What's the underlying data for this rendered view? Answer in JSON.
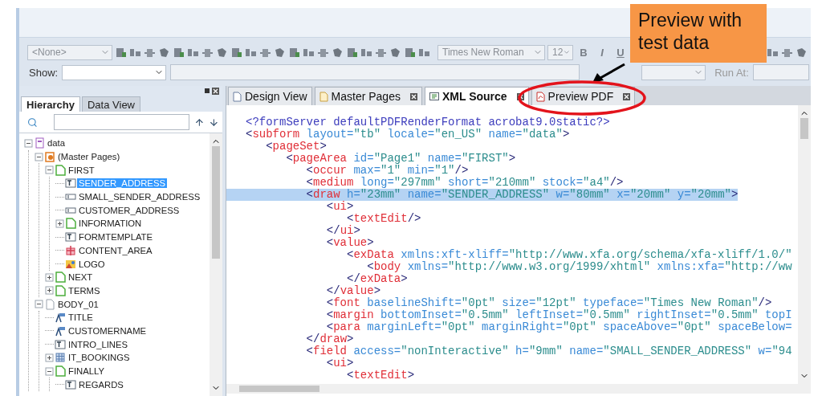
{
  "toolbar": {
    "object_select": "<None>",
    "font": "Times New Roman",
    "size": "12",
    "styles": [
      "B",
      "I",
      "U"
    ]
  },
  "script_bar": {
    "show_label": "Show:",
    "run_at_label": "Run At:"
  },
  "hierarchy": {
    "tabs": [
      {
        "label": "Hierarchy",
        "selected": true
      },
      {
        "label": "Data View",
        "selected": false
      }
    ],
    "tree": [
      {
        "label": "data",
        "kind": "root",
        "expanded": true,
        "selected": false,
        "children": [
          {
            "label": "(Master Pages)",
            "kind": "masterpages",
            "expanded": true,
            "selected": false,
            "children": [
              {
                "label": "FIRST",
                "kind": "page",
                "expanded": true,
                "selected": false,
                "children": [
                  {
                    "label": "SENDER_ADDRESS",
                    "kind": "text",
                    "selected": true
                  },
                  {
                    "label": "SMALL_SENDER_ADDRESS",
                    "kind": "field",
                    "selected": false
                  },
                  {
                    "label": "CUSTOMER_ADDRESS",
                    "kind": "field",
                    "selected": false
                  },
                  {
                    "label": "INFORMATION",
                    "kind": "page",
                    "expanded": false,
                    "selected": false
                  },
                  {
                    "label": "FORMTEMPLATE",
                    "kind": "text",
                    "selected": false
                  },
                  {
                    "label": "CONTENT_AREA",
                    "kind": "content",
                    "selected": false
                  },
                  {
                    "label": "LOGO",
                    "kind": "image",
                    "selected": false
                  }
                ]
              },
              {
                "label": "NEXT",
                "kind": "page",
                "expanded": false,
                "selected": false
              },
              {
                "label": "TERMS",
                "kind": "page",
                "expanded": false,
                "selected": false
              }
            ]
          },
          {
            "label": "BODY_01",
            "kind": "body",
            "expanded": true,
            "selected": false,
            "children": [
              {
                "label": "TITLE",
                "kind": "caption",
                "selected": false
              },
              {
                "label": "CUSTOMERNAME",
                "kind": "caption",
                "selected": false
              },
              {
                "label": "INTRO_LINES",
                "kind": "text",
                "selected": false
              },
              {
                "label": "IT_BOOKINGS",
                "kind": "table",
                "expanded": false,
                "selected": false
              },
              {
                "label": "FINALLY",
                "kind": "subform",
                "expanded": true,
                "selected": false,
                "children": [
                  {
                    "label": "REGARDS",
                    "kind": "text",
                    "selected": false
                  }
                ]
              }
            ]
          }
        ]
      }
    ]
  },
  "editor": {
    "tabs": [
      {
        "label": "Design View",
        "kind": "design",
        "selected": false,
        "closable": false
      },
      {
        "label": "Master Pages",
        "kind": "master",
        "selected": false,
        "closable": true
      },
      {
        "label": "XML Source",
        "kind": "xml",
        "selected": true,
        "closable": true
      },
      {
        "label": "Preview PDF",
        "kind": "pdf",
        "selected": false,
        "closable": true
      }
    ],
    "lines": [
      {
        "selected": false,
        "tokens": [
          {
            "kind": "pi",
            "text": "<?formServer defaultPDFRenderFormat acrobat9.0static?>"
          }
        ]
      },
      {
        "selected": false,
        "tokens": [
          {
            "kind": "punct",
            "text": "<"
          },
          {
            "kind": "tag",
            "text": "subform"
          },
          {
            "kind": "attr",
            "text": " layout="
          },
          {
            "kind": "value",
            "text": "\"tb\""
          },
          {
            "kind": "attr",
            "text": " locale="
          },
          {
            "kind": "value",
            "text": "\"en_US\""
          },
          {
            "kind": "attr",
            "text": " name="
          },
          {
            "kind": "value",
            "text": "\"data\""
          },
          {
            "kind": "punct",
            "text": ">"
          }
        ]
      },
      {
        "selected": false,
        "tokens": [
          {
            "kind": "punct",
            "text": "   <"
          },
          {
            "kind": "tag",
            "text": "pageSet"
          },
          {
            "kind": "punct",
            "text": ">"
          }
        ]
      },
      {
        "selected": false,
        "tokens": [
          {
            "kind": "punct",
            "text": "      <"
          },
          {
            "kind": "tag",
            "text": "pageArea"
          },
          {
            "kind": "attr",
            "text": " id="
          },
          {
            "kind": "value",
            "text": "\"Page1\""
          },
          {
            "kind": "attr",
            "text": " name="
          },
          {
            "kind": "value",
            "text": "\"FIRST\""
          },
          {
            "kind": "punct",
            "text": ">"
          }
        ]
      },
      {
        "selected": false,
        "tokens": [
          {
            "kind": "punct",
            "text": "         <"
          },
          {
            "kind": "tag",
            "text": "occur"
          },
          {
            "kind": "attr",
            "text": " max="
          },
          {
            "kind": "value",
            "text": "\"1\""
          },
          {
            "kind": "attr",
            "text": " min="
          },
          {
            "kind": "value",
            "text": "\"1\""
          },
          {
            "kind": "punct",
            "text": "/>"
          }
        ]
      },
      {
        "selected": false,
        "tokens": [
          {
            "kind": "punct",
            "text": "         <"
          },
          {
            "kind": "tag",
            "text": "medium"
          },
          {
            "kind": "attr",
            "text": " long="
          },
          {
            "kind": "value",
            "text": "\"297mm\""
          },
          {
            "kind": "attr",
            "text": " short="
          },
          {
            "kind": "value",
            "text": "\"210mm\""
          },
          {
            "kind": "attr",
            "text": " stock="
          },
          {
            "kind": "value",
            "text": "\"a4\""
          },
          {
            "kind": "punct",
            "text": "/>"
          }
        ]
      },
      {
        "selected": true,
        "tokens": [
          {
            "kind": "punct",
            "text": "         <"
          },
          {
            "kind": "tag",
            "text": "draw"
          },
          {
            "kind": "attr",
            "text": " h="
          },
          {
            "kind": "value",
            "text": "\"23mm\""
          },
          {
            "kind": "attr",
            "text": " name="
          },
          {
            "kind": "value",
            "text": "\"SENDER_ADDRESS\""
          },
          {
            "kind": "attr",
            "text": " w="
          },
          {
            "kind": "value",
            "text": "\"80mm\""
          },
          {
            "kind": "attr",
            "text": " x="
          },
          {
            "kind": "value",
            "text": "\"20mm\""
          },
          {
            "kind": "attr",
            "text": " y="
          },
          {
            "kind": "value",
            "text": "\"20mm\""
          },
          {
            "kind": "punct",
            "text": ">"
          }
        ]
      },
      {
        "selected": false,
        "tokens": [
          {
            "kind": "punct",
            "text": "            <"
          },
          {
            "kind": "tag",
            "text": "ui"
          },
          {
            "kind": "punct",
            "text": ">"
          }
        ]
      },
      {
        "selected": false,
        "tokens": [
          {
            "kind": "punct",
            "text": "               <"
          },
          {
            "kind": "tag",
            "text": "textEdit"
          },
          {
            "kind": "punct",
            "text": "/>"
          }
        ]
      },
      {
        "selected": false,
        "tokens": [
          {
            "kind": "punct",
            "text": "            </"
          },
          {
            "kind": "tag",
            "text": "ui"
          },
          {
            "kind": "punct",
            "text": ">"
          }
        ]
      },
      {
        "selected": false,
        "tokens": [
          {
            "kind": "punct",
            "text": "            <"
          },
          {
            "kind": "tag",
            "text": "value"
          },
          {
            "kind": "punct",
            "text": ">"
          }
        ]
      },
      {
        "selected": false,
        "tokens": [
          {
            "kind": "punct",
            "text": "               <"
          },
          {
            "kind": "tag",
            "text": "exData"
          },
          {
            "kind": "attr",
            "text": " xmlns:xft-xliff="
          },
          {
            "kind": "value",
            "text": "\"http://www.xfa.org/schema/xfa-xliff/1.0/\""
          }
        ]
      },
      {
        "selected": false,
        "tokens": [
          {
            "kind": "punct",
            "text": "                  <"
          },
          {
            "kind": "tag",
            "text": "body"
          },
          {
            "kind": "attr",
            "text": " xmlns="
          },
          {
            "kind": "value",
            "text": "\"http://www.w3.org/1999/xhtml\""
          },
          {
            "kind": "attr",
            "text": " xmlns:xfa="
          },
          {
            "kind": "value",
            "text": "\"http://ww"
          }
        ]
      },
      {
        "selected": false,
        "tokens": [
          {
            "kind": "punct",
            "text": "               </"
          },
          {
            "kind": "tag",
            "text": "exData"
          },
          {
            "kind": "punct",
            "text": ">"
          }
        ]
      },
      {
        "selected": false,
        "tokens": [
          {
            "kind": "punct",
            "text": "            </"
          },
          {
            "kind": "tag",
            "text": "value"
          },
          {
            "kind": "punct",
            "text": ">"
          }
        ]
      },
      {
        "selected": false,
        "tokens": [
          {
            "kind": "punct",
            "text": "            <"
          },
          {
            "kind": "tag",
            "text": "font"
          },
          {
            "kind": "attr",
            "text": " baselineShift="
          },
          {
            "kind": "value",
            "text": "\"0pt\""
          },
          {
            "kind": "attr",
            "text": " size="
          },
          {
            "kind": "value",
            "text": "\"12pt\""
          },
          {
            "kind": "attr",
            "text": " typeface="
          },
          {
            "kind": "value",
            "text": "\"Times New Roman\""
          },
          {
            "kind": "punct",
            "text": "/>"
          }
        ]
      },
      {
        "selected": false,
        "tokens": [
          {
            "kind": "punct",
            "text": "            <"
          },
          {
            "kind": "tag",
            "text": "margin"
          },
          {
            "kind": "attr",
            "text": " bottomInset="
          },
          {
            "kind": "value",
            "text": "\"0.5mm\""
          },
          {
            "kind": "attr",
            "text": " leftInset="
          },
          {
            "kind": "value",
            "text": "\"0.5mm\""
          },
          {
            "kind": "attr",
            "text": " rightInset="
          },
          {
            "kind": "value",
            "text": "\"0.5mm\""
          },
          {
            "kind": "attr",
            "text": " topI"
          }
        ]
      },
      {
        "selected": false,
        "tokens": [
          {
            "kind": "punct",
            "text": "            <"
          },
          {
            "kind": "tag",
            "text": "para"
          },
          {
            "kind": "attr",
            "text": " marginLeft="
          },
          {
            "kind": "value",
            "text": "\"0pt\""
          },
          {
            "kind": "attr",
            "text": " marginRight="
          },
          {
            "kind": "value",
            "text": "\"0pt\""
          },
          {
            "kind": "attr",
            "text": " spaceAbove="
          },
          {
            "kind": "value",
            "text": "\"0pt\""
          },
          {
            "kind": "attr",
            "text": " spaceBelow="
          }
        ]
      },
      {
        "selected": false,
        "tokens": [
          {
            "kind": "punct",
            "text": "         </"
          },
          {
            "kind": "tag",
            "text": "draw"
          },
          {
            "kind": "punct",
            "text": ">"
          }
        ]
      },
      {
        "selected": false,
        "tokens": [
          {
            "kind": "punct",
            "text": "         <"
          },
          {
            "kind": "tag",
            "text": "field"
          },
          {
            "kind": "attr",
            "text": " access="
          },
          {
            "kind": "value",
            "text": "\"nonInteractive\""
          },
          {
            "kind": "attr",
            "text": " h="
          },
          {
            "kind": "value",
            "text": "\"9mm\""
          },
          {
            "kind": "attr",
            "text": " name="
          },
          {
            "kind": "value",
            "text": "\"SMALL_SENDER_ADDRESS\""
          },
          {
            "kind": "attr",
            "text": " w="
          },
          {
            "kind": "value",
            "text": "\"94"
          }
        ]
      },
      {
        "selected": false,
        "tokens": [
          {
            "kind": "punct",
            "text": "            <"
          },
          {
            "kind": "tag",
            "text": "ui"
          },
          {
            "kind": "punct",
            "text": ">"
          }
        ]
      },
      {
        "selected": false,
        "tokens": [
          {
            "kind": "punct",
            "text": "               <"
          },
          {
            "kind": "tag",
            "text": "textEdit"
          },
          {
            "kind": "punct",
            "text": ">"
          }
        ]
      }
    ]
  },
  "callout": {
    "text": "Preview with test data"
  }
}
